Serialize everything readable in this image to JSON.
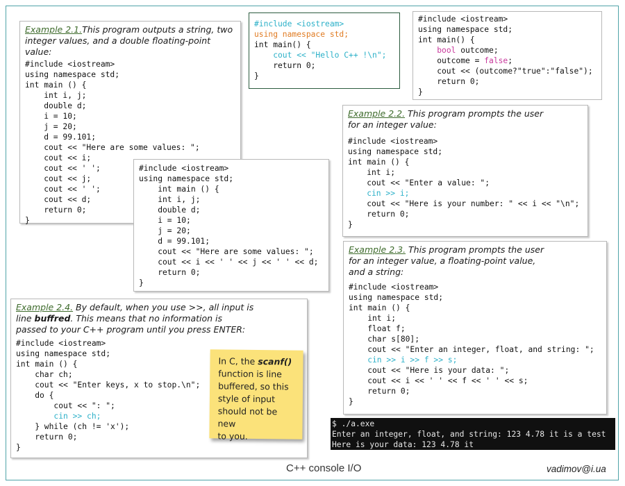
{
  "colors": {
    "frame": "#4fa3a8",
    "caption_link": "#3e6b2c",
    "stream": "#2bb0c8",
    "preprocessor": "#e07b22",
    "keyword": "#c8379b",
    "note": "#fbe27a",
    "terminal": "#101010"
  },
  "ex21": {
    "label": "Example 2.1.",
    "text": "This program outputs a string, two",
    "text2": "integer values, and a double  floating-point value:",
    "code": [
      "#include <iostream>",
      "using namespace std;",
      "int main () {",
      "    int i, j;",
      "    double d;",
      "    i = 10;",
      "    j = 20;",
      "    d = 99.101;",
      "    cout << \"Here are some values: \";",
      "    cout << i;",
      "    cout << ' ';",
      "    cout << j;",
      "    cout << ' ';",
      "    cout << d;",
      "    return 0;",
      "}"
    ]
  },
  "hello": {
    "code": [
      "#include <iostream>",
      "using namespace std;",
      "int main() {",
      "    cout << \"Hello C++ !\\n\";",
      "    return 0;",
      "}"
    ]
  },
  "bool_box": {
    "code": [
      "#include <iostream>",
      "using namespace std;",
      "int main() {",
      "    bool outcome;",
      "    outcome = false;",
      "    cout << (outcome?\"true\":\"false\");",
      "    return 0;",
      "}"
    ],
    "kw_bool": "bool",
    "kw_false": "false"
  },
  "compact": {
    "code": [
      "#include <iostream>",
      "using namespace std;",
      "    int main () {",
      "    int i, j;",
      "    double d;",
      "    i = 10;",
      "    j = 20;",
      "    d = 99.101;",
      "    cout << \"Here are some values: \";",
      "    cout << i << ' ' << j << ' ' << d;",
      "    return 0;",
      "}"
    ]
  },
  "ex22": {
    "label": "Example 2.2.",
    "text": " This program prompts the user",
    "text2": "for an integer value:",
    "code": [
      "#include <iostream>",
      "using namespace std;",
      "int main () {",
      "    int i;",
      "    cout << \"Enter a value: \";",
      "    cin >> i;",
      "    cout << \"Here is your number: \" << i << \"\\n\";",
      "    return 0;",
      "}"
    ]
  },
  "ex23": {
    "label": "Example 2.3.",
    "text": " This program prompts the user",
    "text2": "for an integer value, a floating-point value,",
    "text3": "and a string:",
    "code": [
      "#include <iostream>",
      "using namespace std;",
      "int main () {",
      "    int i;",
      "    float f;",
      "    char s[80];",
      "    cout << \"Enter an integer, float, and string: \";",
      "    cin >> i >> f >> s;",
      "    cout << \"Here is your data: \";",
      "    cout << i << ' ' << f << ' ' << s;",
      "    return 0;",
      "}"
    ]
  },
  "ex24": {
    "label": "Example 2.4.",
    "text": " By default, when you use >>, all input is",
    "text2a": "line ",
    "text2b": "buffred",
    "text2c": ". This means that no information is",
    "text3": "passed to your C++ program until you press ENTER:",
    "code": [
      "#include <iostream>",
      "using namespace std;",
      "int main () {",
      "    char ch;",
      "    cout << \"Enter keys, x to stop.\\n\";",
      "    do {",
      "        cout << \": \";",
      "        cin >> ch;",
      "    } while (ch != 'x');",
      "    return 0;",
      "}"
    ]
  },
  "note": {
    "l1a": "In C, the ",
    "l1b": "scanf()",
    "l2": "function is line",
    "l3": "buffered, so this",
    "l4": "style of input",
    "l5": "should not be new",
    "l6": "to you."
  },
  "terminal": {
    "lines": [
      "$ ./a.exe",
      "Enter an integer, float, and string: 123 4.78 it is a test",
      "Here is your data: 123 4.78 it"
    ]
  },
  "footer": {
    "title": "C++ console I/O",
    "email": "vadimov@i.ua"
  }
}
